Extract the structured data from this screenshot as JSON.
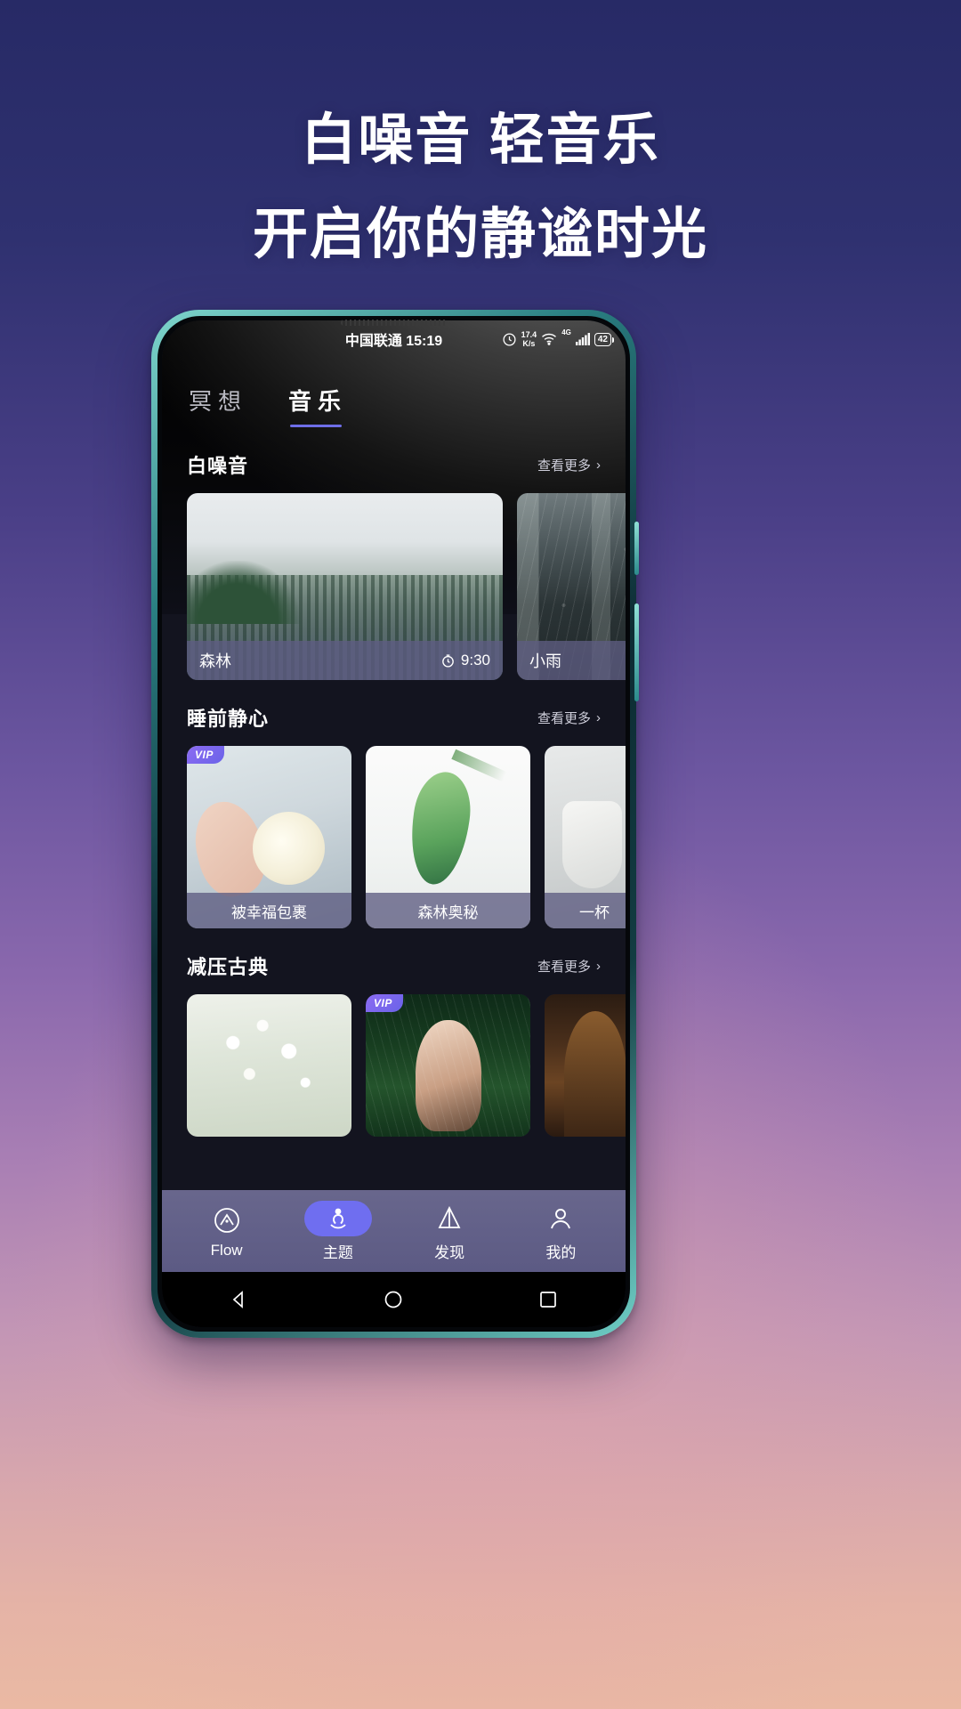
{
  "poster": {
    "headline_line1": "白噪音 轻音乐",
    "headline_line2": "开启你的静谧时光"
  },
  "statusbar": {
    "carrier_time": "中国联通 15:19",
    "alarm_icon": "alarm-icon",
    "netspeed_value": "17.4",
    "netspeed_unit": "K/s",
    "wifi_icon": "wifi-icon",
    "network_type": "4G",
    "signal_icon": "signal-bars-icon",
    "battery_level": "42"
  },
  "tabs": [
    {
      "label": "冥想",
      "active": false
    },
    {
      "label": "音乐",
      "active": true
    }
  ],
  "sections": [
    {
      "title": "白噪音",
      "more_label": "查看更多",
      "more_chevron": "›",
      "cards": [
        {
          "title": "森林",
          "duration": "9:30",
          "clock_icon": "clock-icon",
          "vip": false
        },
        {
          "title": "小雨",
          "duration": "",
          "vip": false
        }
      ]
    },
    {
      "title": "睡前静心",
      "more_label": "查看更多",
      "more_chevron": "›",
      "cards": [
        {
          "title": "被幸福包裹",
          "vip": true,
          "vip_label": "VIP"
        },
        {
          "title": "森林奥秘",
          "vip": false
        },
        {
          "title": "一杯",
          "vip": false
        }
      ]
    },
    {
      "title": "减压古典",
      "more_label": "查看更多",
      "more_chevron": "›",
      "cards": [
        {
          "title": "",
          "vip": false
        },
        {
          "title": "",
          "vip": true,
          "vip_label": "VIP"
        },
        {
          "title": "",
          "vip": false
        }
      ]
    }
  ],
  "bottom_nav": [
    {
      "label": "Flow",
      "icon": "flow-circle-icon",
      "active": false
    },
    {
      "label": "主题",
      "icon": "meditation-person-icon",
      "active": true
    },
    {
      "label": "发现",
      "icon": "prism-icon",
      "active": false
    },
    {
      "label": "我的",
      "icon": "person-icon",
      "active": false
    }
  ],
  "system_nav": {
    "back_icon": "triangle-back-icon",
    "home_icon": "circle-home-icon",
    "recents_icon": "square-recents-icon"
  },
  "colors": {
    "accent": "#6f6ef0",
    "app_bg": "#13141f",
    "card_bar": "#5d5c82",
    "poster_top": "#272a66",
    "poster_bottom": "#eab9a3"
  }
}
